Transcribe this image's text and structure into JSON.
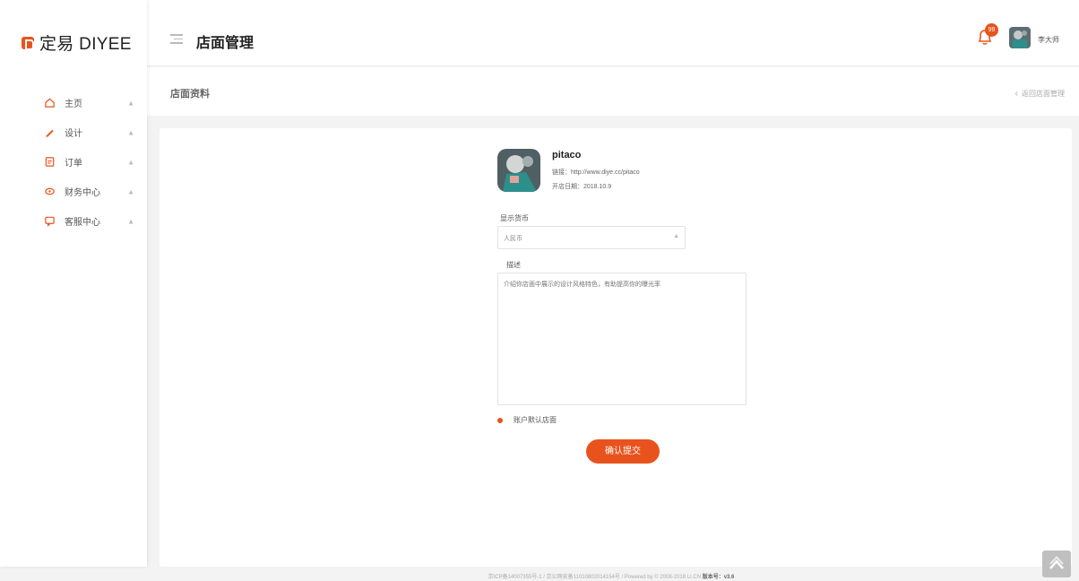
{
  "brand": {
    "name": "定易 DIYEE",
    "accent": "#e8531d"
  },
  "sidebar": {
    "items": [
      {
        "label": "主页",
        "icon": "home-icon"
      },
      {
        "label": "设计",
        "icon": "pencil-icon"
      },
      {
        "label": "订单",
        "icon": "order-icon"
      },
      {
        "label": "财务中心",
        "icon": "finance-icon"
      },
      {
        "label": "客服中心",
        "icon": "chat-icon"
      }
    ]
  },
  "header": {
    "title": "店面管理",
    "notification_count": "99",
    "username": "李大师"
  },
  "subheader": {
    "title": "店面资料",
    "back_label": "返回店面管理"
  },
  "shop": {
    "name": "pitaco",
    "domain": "链接：http://www.diye.cc/pitaco",
    "open_date": "开店日期：2018.10.9"
  },
  "form": {
    "display_label": "显示货币",
    "display_value": "人民币",
    "desc_label": "描述",
    "desc_placeholder": "介绍你店面中展示的设计风格特色，有助提高你的曝光率",
    "radio_label": "账户默认店面",
    "submit_label": "确认提交"
  },
  "footer": {
    "text": "京ICP备14007355号-1 / 京公网安备11010802014154号 / Powered by © 2008-2018 LI.CN",
    "version": "版本号：v3.6"
  }
}
